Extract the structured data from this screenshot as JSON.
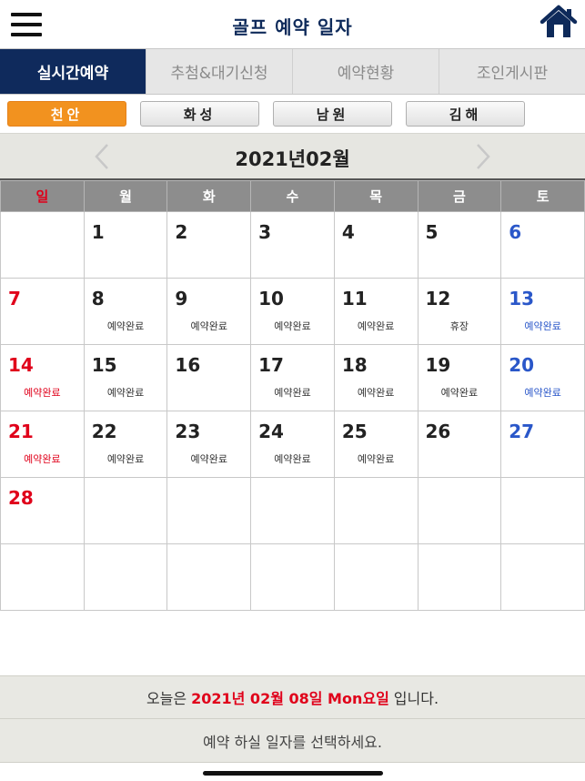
{
  "header": {
    "title": "골프 예약 일자",
    "menu_icon": "hamburger-menu-icon",
    "home_icon": "home-icon",
    "title_color": "#0e2a5a"
  },
  "tabs": [
    {
      "label": "실시간예약",
      "active": true
    },
    {
      "label": "추첨&대기신청",
      "active": false
    },
    {
      "label": "예약현황",
      "active": false
    },
    {
      "label": "조인게시판",
      "active": false
    }
  ],
  "courses": [
    {
      "label": "천안",
      "active": true
    },
    {
      "label": "화성",
      "active": false
    },
    {
      "label": "남원",
      "active": false
    },
    {
      "label": "김해",
      "active": false
    }
  ],
  "calendar": {
    "month_title": "2021년02월",
    "weekdays": [
      "일",
      "월",
      "화",
      "수",
      "목",
      "금",
      "토"
    ],
    "weeks": [
      [
        {
          "day": "",
          "status": ""
        },
        {
          "day": "1",
          "status": ""
        },
        {
          "day": "2",
          "status": ""
        },
        {
          "day": "3",
          "status": ""
        },
        {
          "day": "4",
          "status": ""
        },
        {
          "day": "5",
          "status": ""
        },
        {
          "day": "6",
          "status": ""
        }
      ],
      [
        {
          "day": "7",
          "status": ""
        },
        {
          "day": "8",
          "status": "예약완료"
        },
        {
          "day": "9",
          "status": "예약완료"
        },
        {
          "day": "10",
          "status": "예약완료"
        },
        {
          "day": "11",
          "status": "예약완료"
        },
        {
          "day": "12",
          "status": "휴장"
        },
        {
          "day": "13",
          "status": "예약완료"
        }
      ],
      [
        {
          "day": "14",
          "status": "예약완료"
        },
        {
          "day": "15",
          "status": "예약완료"
        },
        {
          "day": "16",
          "status": ""
        },
        {
          "day": "17",
          "status": "예약완료"
        },
        {
          "day": "18",
          "status": "예약완료"
        },
        {
          "day": "19",
          "status": "예약완료"
        },
        {
          "day": "20",
          "status": "예약완료"
        }
      ],
      [
        {
          "day": "21",
          "status": "예약완료"
        },
        {
          "day": "22",
          "status": "예약완료"
        },
        {
          "day": "23",
          "status": "예약완료"
        },
        {
          "day": "24",
          "status": "예약완료"
        },
        {
          "day": "25",
          "status": "예약완료"
        },
        {
          "day": "26",
          "status": ""
        },
        {
          "day": "27",
          "status": ""
        }
      ],
      [
        {
          "day": "28",
          "status": ""
        },
        {
          "day": "",
          "status": ""
        },
        {
          "day": "",
          "status": ""
        },
        {
          "day": "",
          "status": ""
        },
        {
          "day": "",
          "status": ""
        },
        {
          "day": "",
          "status": ""
        },
        {
          "day": "",
          "status": ""
        }
      ],
      [
        {
          "day": "",
          "status": ""
        },
        {
          "day": "",
          "status": ""
        },
        {
          "day": "",
          "status": ""
        },
        {
          "day": "",
          "status": ""
        },
        {
          "day": "",
          "status": ""
        },
        {
          "day": "",
          "status": ""
        },
        {
          "day": "",
          "status": ""
        }
      ]
    ],
    "colors": {
      "sunday": "#e0001a",
      "saturday": "#2a57c9",
      "header_bg": "#8d8d8d"
    }
  },
  "footer": {
    "today_prefix": "오늘은",
    "today_value": "2021년 02월 08일 Mon요일",
    "today_suffix": "입니다.",
    "guide": "예약 하실 일자를 선택하세요."
  },
  "colors": {
    "tab_active_bg": "#0f2a5c",
    "course_active_bg": "#f2921f",
    "highlight": "#e0001a"
  }
}
